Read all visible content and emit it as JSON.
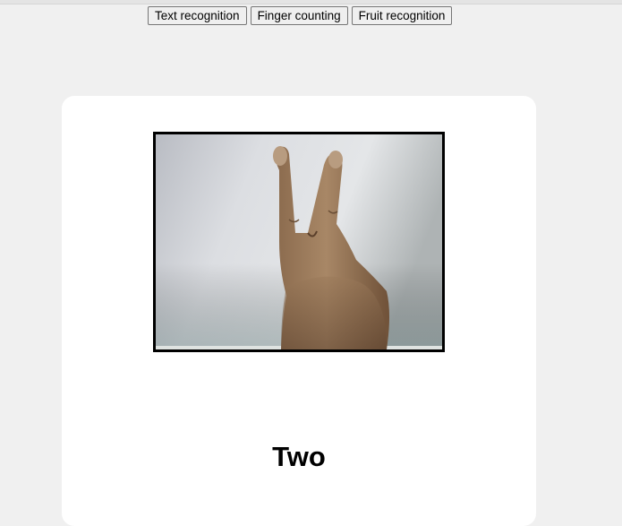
{
  "nav": {
    "buttons": [
      {
        "label": "Text recognition"
      },
      {
        "label": "Finger counting"
      },
      {
        "label": "Fruit recognition"
      }
    ]
  },
  "camera": {
    "content": "hand showing two fingers"
  },
  "result": {
    "label": "Two"
  }
}
